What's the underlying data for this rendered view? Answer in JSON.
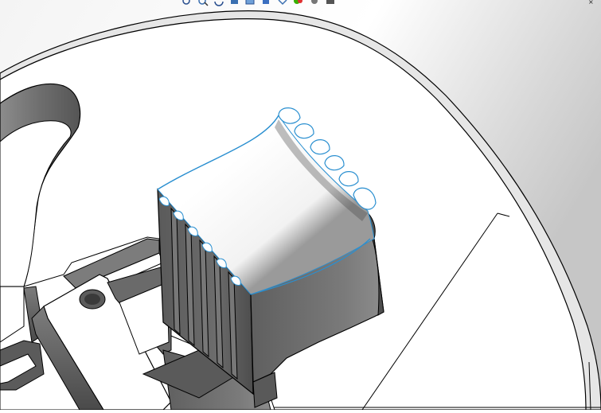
{
  "app": {
    "kind": "3D CAD model viewport"
  },
  "toolbar": {
    "icons": [
      "zoom-to-fit-icon",
      "zoom-area-icon",
      "rotate-view-icon",
      "section-view-icon",
      "view-orientation-icon",
      "display-style-icon",
      "hide-show-icon",
      "appearance-icon",
      "scene-icon",
      "display-settings-icon"
    ]
  },
  "colors": {
    "background": "#ffffff",
    "background_shade": "#cfcfcf",
    "model_face": "#ffffff",
    "model_wall": "#6a6a6a",
    "model_wall_dark": "#4a4a4a",
    "edge": "#000000",
    "selected_edge": "#2a8fd0",
    "status_appearance": "#38b000"
  },
  "window": {
    "close_glyph": "×"
  }
}
